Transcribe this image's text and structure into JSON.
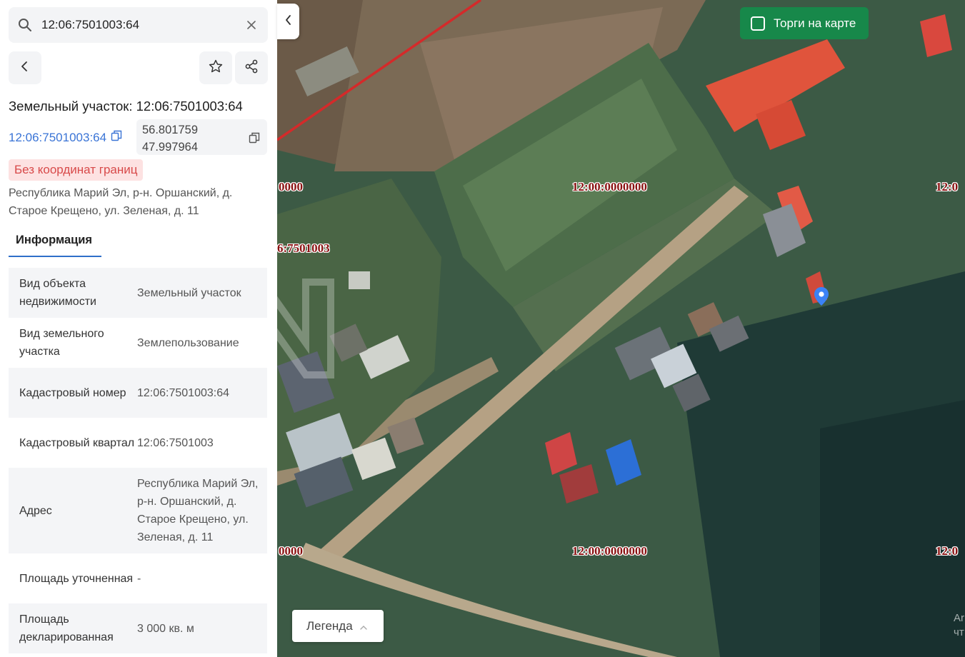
{
  "search": {
    "value": "12:06:7501003:64"
  },
  "title": "Земельный участок: 12:06:7501003:64",
  "cadastral_link": "12:06:7501003:64",
  "coordinates": {
    "lat": "56.801759",
    "lon": "47.997964"
  },
  "badge": "Без координат границ",
  "address": "Республика Марий Эл, р-н. Оршанский, д. Старое Крещено, ул. Зеленая, д. 11",
  "tabs": [
    {
      "label": "Информация"
    }
  ],
  "info": [
    {
      "key": "Вид объекта недвижимости",
      "value": "Земельный участок"
    },
    {
      "key": "Вид земельного участка",
      "value": "Землепользование"
    },
    {
      "key": "Кадастровый номер",
      "value": "12:06:7501003:64"
    },
    {
      "key": "Кадастровый квартал",
      "value": "12:06:7501003"
    },
    {
      "key": "Адрес",
      "value": "Республика Марий Эл, р-н. Оршанский, д. Старое Крещено, ул. Зеленая, д. 11"
    },
    {
      "key": "Площадь уточненная",
      "value": "-"
    },
    {
      "key": "Площадь декларированная",
      "value": "3 000 кв. м"
    }
  ],
  "map": {
    "torgi_label": "Торги на карте",
    "legend_label": "Легенда",
    "labels": [
      {
        "text": "0000"
      },
      {
        "text": "12:00:0000000"
      },
      {
        "text": "12:0"
      },
      {
        "text": "6:7501003"
      },
      {
        "text": "0000"
      },
      {
        "text": "12:00:0000000"
      },
      {
        "text": "12:0"
      }
    ],
    "corner_text": "Ar\nчт"
  },
  "colors": {
    "link": "#3a74d6",
    "badge_bg": "#fde2e2",
    "badge_text": "#d84a4a",
    "torgi": "#17884a",
    "pin": "#3b82f6"
  },
  "icons": [
    "search-icon",
    "close-icon",
    "chevron-left-icon",
    "star-icon",
    "share-icon",
    "copy-icon",
    "checkbox-icon",
    "chevron-up-icon",
    "map-pin-icon"
  ]
}
